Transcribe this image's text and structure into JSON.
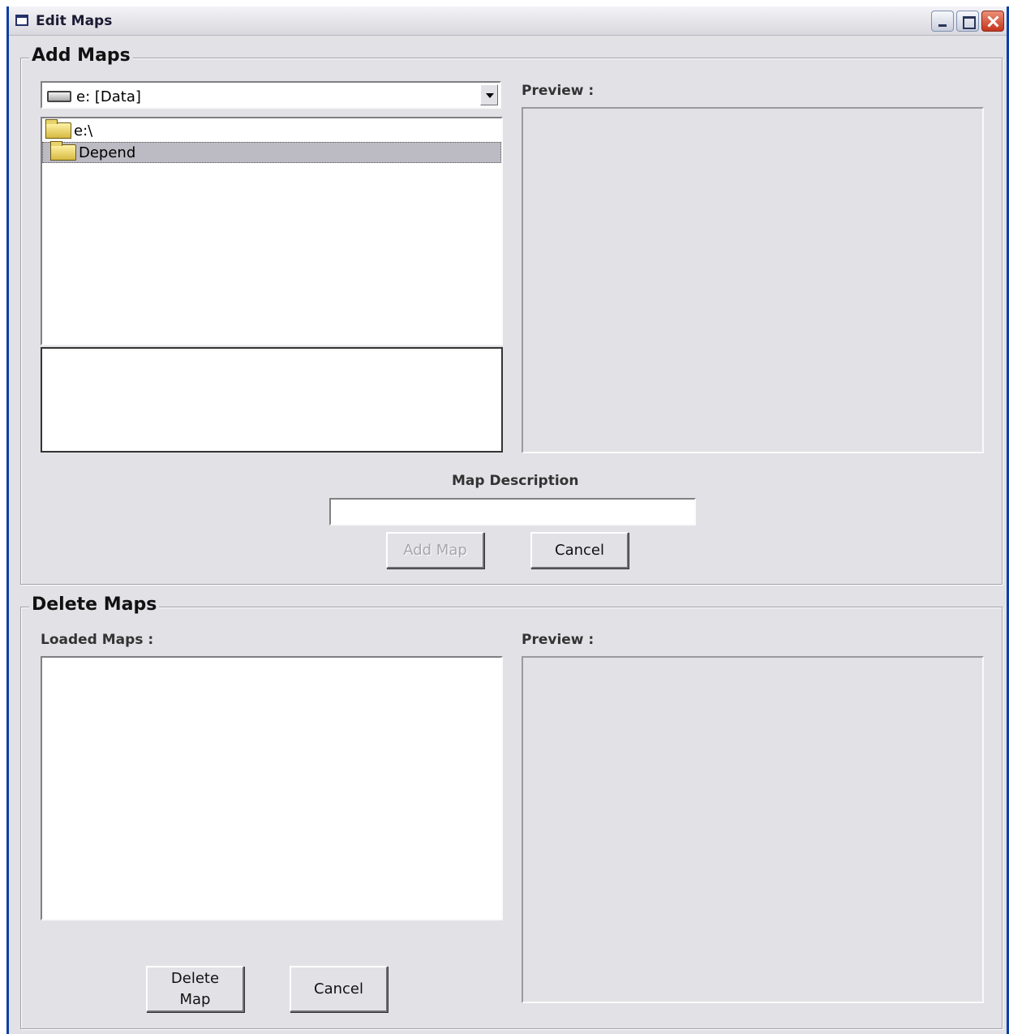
{
  "window": {
    "title": "Edit Maps",
    "icon": "app-window-icon",
    "controls": [
      "minimize-icon",
      "maximize-icon",
      "close-icon"
    ]
  },
  "add_maps": {
    "legend": "Add Maps",
    "drive_select": {
      "value": "e: [Data]",
      "icon": "drive-icon"
    },
    "directory_tree": [
      {
        "label": "e:\\",
        "icon": "open-folder-icon",
        "selected": false
      },
      {
        "label": "Depend",
        "icon": "open-folder-icon",
        "selected": true
      }
    ],
    "file_list": [],
    "preview_label": "Preview :",
    "description_label": "Map Description",
    "description_value": "",
    "add_button": {
      "label": "Add Map",
      "enabled": false
    },
    "cancel_button": {
      "label": "Cancel"
    }
  },
  "delete_maps": {
    "legend": "Delete Maps",
    "loaded_label": "Loaded Maps :",
    "loaded_maps": [],
    "preview_label": "Preview :",
    "delete_button": {
      "label": "Delete\nMap"
    },
    "cancel_button": {
      "label": "Cancel"
    }
  }
}
